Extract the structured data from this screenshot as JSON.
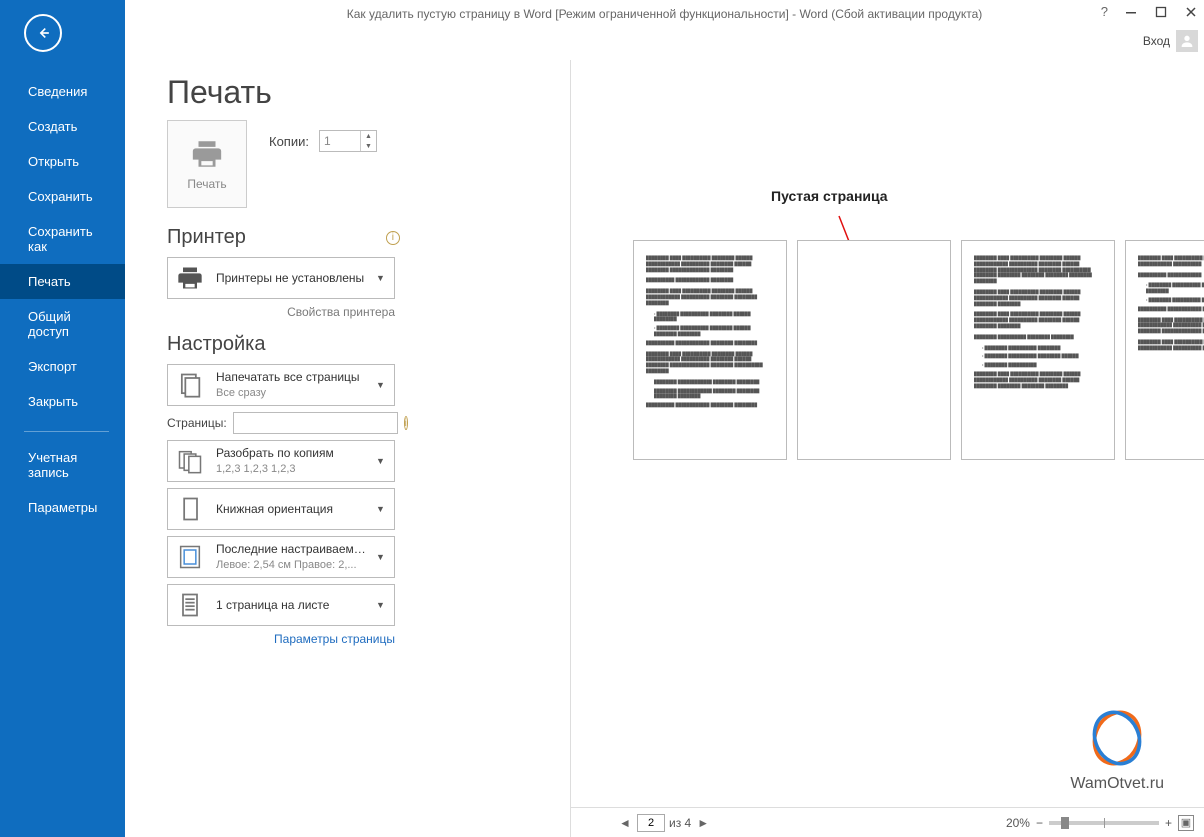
{
  "window": {
    "title": "Как удалить пустую страницу в Word [Режим ограниченной функциональности] - Word (Сбой активации продукта)",
    "sign_in": "Вход"
  },
  "sidebar": {
    "items": [
      "Сведения",
      "Создать",
      "Открыть",
      "Сохранить",
      "Сохранить как",
      "Печать",
      "Общий доступ",
      "Экспорт",
      "Закрыть"
    ],
    "items2": [
      "Учетная запись",
      "Параметры"
    ],
    "active_index": 5
  },
  "page": {
    "title": "Печать",
    "print_label": "Печать",
    "copies_label": "Копии:",
    "copies_value": "1",
    "printer_header": "Принтер",
    "printer_dd": "Принтеры не установлены",
    "printer_link": "Свойства принтера",
    "settings_header": "Настройка",
    "print_all": {
      "main": "Напечатать все страницы",
      "sub": "Все сразу"
    },
    "pages_label": "Страницы:",
    "collate": {
      "main": "Разобрать по копиям",
      "sub": "1,2,3    1,2,3    1,2,3"
    },
    "orientation": "Книжная ориентация",
    "margins": {
      "main": "Последние настраиваемые...",
      "sub": "Левое: 2,54 см   Правое: 2,..."
    },
    "ppp": "1 страница на листе",
    "page_setup_link": "Параметры страницы"
  },
  "preview": {
    "annotation": "Пустая страница",
    "current_page": "2",
    "page_of": "из 4",
    "zoom": "20%",
    "watermark": "WamOtvet.ru"
  }
}
